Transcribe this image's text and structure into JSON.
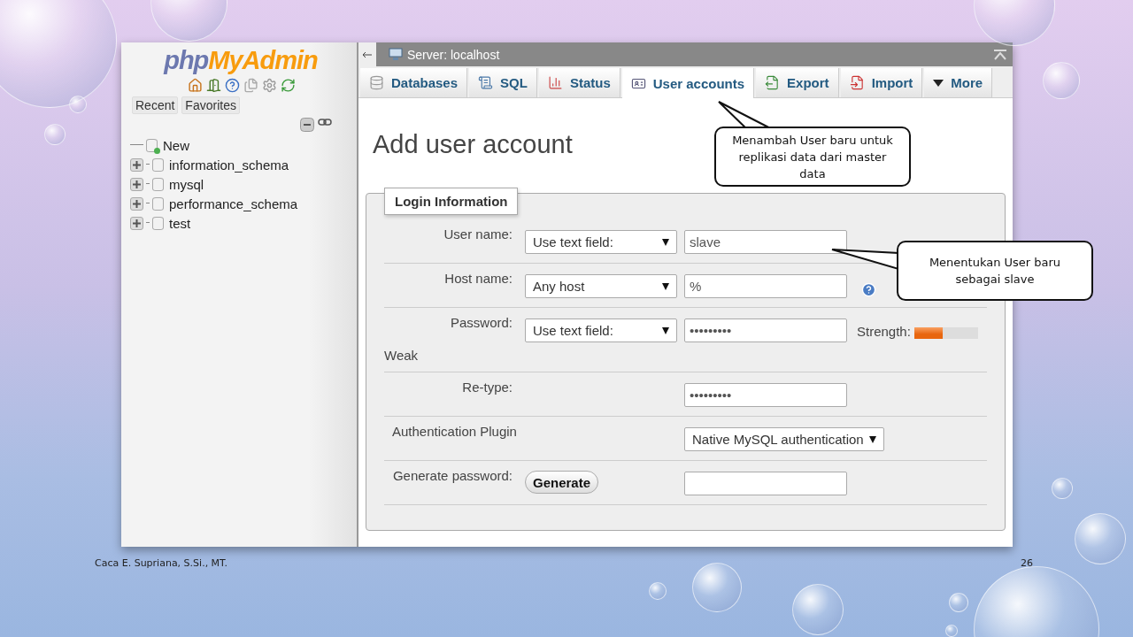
{
  "sidebar": {
    "logo_prefix": "php",
    "logo_suffix": "MyAdmin",
    "tabs": [
      {
        "label": "Recent"
      },
      {
        "label": "Favorites"
      }
    ],
    "tree": [
      {
        "kind": "new",
        "label": "New"
      },
      {
        "kind": "db",
        "label": "information_schema",
        "expanded": false
      },
      {
        "kind": "db",
        "label": "mysql",
        "expanded": false
      },
      {
        "kind": "db",
        "label": "performance_schema",
        "expanded": false
      },
      {
        "kind": "db",
        "label": "test",
        "expanded": false
      }
    ]
  },
  "header": {
    "title": "Server: localhost"
  },
  "tabs": [
    {
      "label": "Databases",
      "selected": false
    },
    {
      "label": "SQL",
      "selected": false
    },
    {
      "label": "Status",
      "selected": false
    },
    {
      "label": "User accounts",
      "selected": true
    },
    {
      "label": "Export",
      "selected": false
    },
    {
      "label": "Import",
      "selected": false
    },
    {
      "label": "More",
      "selected": false
    }
  ],
  "page_title": "Add user account",
  "fieldset": {
    "legend": "Login Information",
    "rows": [
      {
        "label": "User name:",
        "select": "Use text field:",
        "value": "slave"
      },
      {
        "label": "Host name:",
        "select": "Any host",
        "value": "%",
        "help": true
      },
      {
        "label": "Password:",
        "select": "Use text field:",
        "value": "•••••••••",
        "strength": {
          "label": "Strength:",
          "level": 0.45,
          "rating": "Weak"
        }
      },
      {
        "label": "Re-type:",
        "value": "•••••••••"
      },
      {
        "label": "Authentication Plugin",
        "plugin": "Native MySQL authentication"
      },
      {
        "label": "Generate password:",
        "button": "Generate",
        "value": ""
      }
    ]
  },
  "callouts": [
    {
      "text": "Menambah User baru untuk replikasi data dari master data"
    },
    {
      "text": "Menentukan User baru sebagai slave"
    }
  ],
  "slide": {
    "footer": "Caca E. Supriana, S.Si., MT.",
    "page_number": "26"
  }
}
